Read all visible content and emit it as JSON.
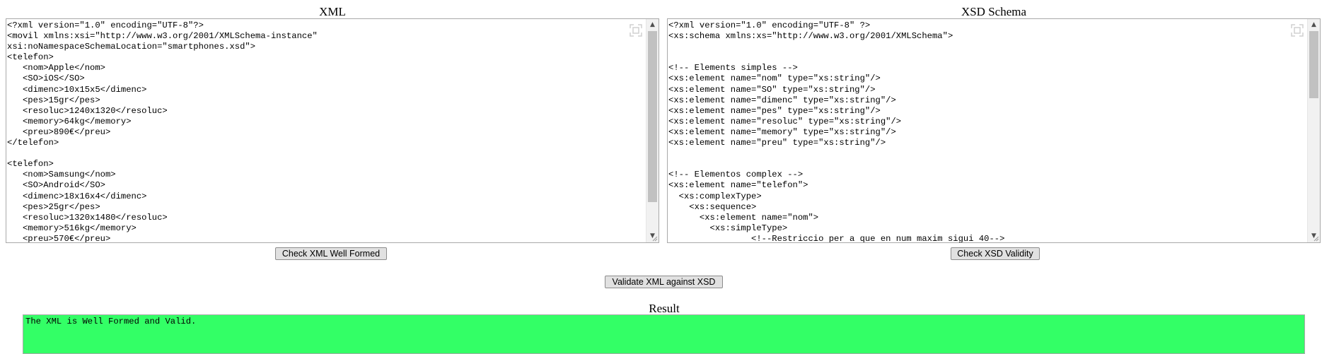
{
  "xml_panel": {
    "title": "XML",
    "content": "<?xml version=\"1.0\" encoding=\"UTF-8\"?>\n<movil xmlns:xsi=\"http://www.w3.org/2001/XMLSchema-instance\"\nxsi:noNamespaceSchemaLocation=\"smartphones.xsd\">\n<telefon>\n   <nom>Apple</nom>\n   <SO>iOS</SO>\n   <dimenc>10x15x5</dimenc>\n   <pes>15gr</pes>\n   <resoluc>1240x1320</resoluc>\n   <memory>64kg</memory>\n   <preu>890€</preu>\n</telefon>\n\n<telefon>\n   <nom>Samsung</nom>\n   <SO>Android</SO>\n   <dimenc>18x16x4</dimenc>\n   <pes>25gr</pes>\n   <resoluc>1320x1480</resoluc>\n   <memory>516kg</memory>\n   <preu>570€</preu>"
  },
  "xsd_panel": {
    "title": "XSD Schema",
    "content": "<?xml version=\"1.0\" encoding=\"UTF-8\" ?>\n<xs:schema xmlns:xs=\"http://www.w3.org/2001/XMLSchema\">\n\n\n<!-- Elements simples -->\n<xs:element name=\"nom\" type=\"xs:string\"/>\n<xs:element name=\"SO\" type=\"xs:string\"/>\n<xs:element name=\"dimenc\" type=\"xs:string\"/>\n<xs:element name=\"pes\" type=\"xs:string\"/>\n<xs:element name=\"resoluc\" type=\"xs:string\"/>\n<xs:element name=\"memory\" type=\"xs:string\"/>\n<xs:element name=\"preu\" type=\"xs:string\"/>\n\n\n<!-- Elementos complex -->\n<xs:element name=\"telefon\">\n  <xs:complexType>\n    <xs:sequence>\n      <xs:element name=\"nom\">\n        <xs:simpleType>\n                <!--Restriccio per a que en num maxim sigui 40-->"
  },
  "buttons": {
    "check_xml": "Check XML Well Formed",
    "check_xsd": "Check XSD Validity",
    "validate": "Validate XML against XSD"
  },
  "result": {
    "title": "Result",
    "message": "The XML is Well Formed and Valid.",
    "status_color": "#33ff66"
  },
  "icons": {
    "expand": "expand-icon",
    "scroll_up": "chevron-up-icon",
    "scroll_down": "chevron-down-icon",
    "resize": "resize-grip-icon"
  }
}
